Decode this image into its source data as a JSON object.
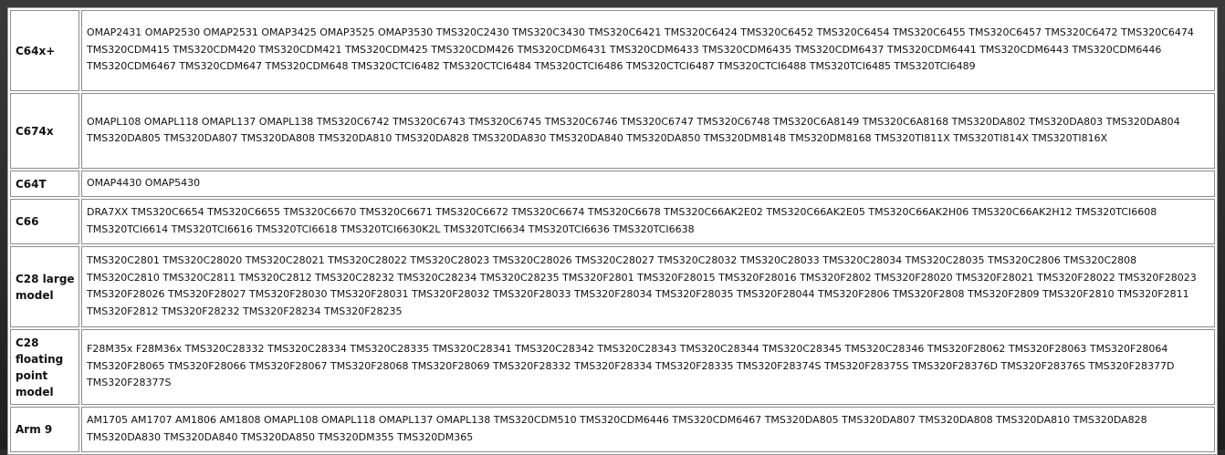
{
  "rows": [
    {
      "family": "C64x+",
      "devices": "OMAP2431 OMAP2530 OMAP2531 OMAP3425 OMAP3525 OMAP3530 TMS320C2430 TMS320C3430 TMS320C6421 TMS320C6424 TMS320C6452 TMS320C6454 TMS320C6455 TMS320C6457 TMS320C6472 TMS320C6474 TMS320CDM415 TMS320CDM420 TMS320CDM421 TMS320CDM425 TMS320CDM426 TMS320CDM6431 TMS320CDM6433 TMS320CDM6435 TMS320CDM6437 TMS320CDM6441 TMS320CDM6443 TMS320CDM6446 TMS320CDM6467 TMS320CDM647 TMS320CDM648 TMS320CTCI6482 TMS320CTCI6484 TMS320CTCI6486 TMS320CTCI6487 TMS320CTCI6488 TMS320TCI6485 TMS320TCI6489"
    },
    {
      "family": "C674x",
      "devices": "OMAPL108 OMAPL118 OMAPL137 OMAPL138 TMS320C6742 TMS320C6743 TMS320C6745 TMS320C6746 TMS320C6747 TMS320C6748 TMS320C6A8149 TMS320C6A8168 TMS320DA802 TMS320DA803 TMS320DA804 TMS320DA805 TMS320DA807 TMS320DA808 TMS320DA810 TMS320DA828 TMS320DA830 TMS320DA840 TMS320DA850 TMS320DM8148 TMS320DM8168 TMS320TI811X TMS320TI814X TMS320TI816X"
    },
    {
      "family": "C64T",
      "devices": "OMAP4430 OMAP5430"
    },
    {
      "family": "C66",
      "devices": "DRA7XX TMS320C6654 TMS320C6655 TMS320C6670 TMS320C6671 TMS320C6672 TMS320C6674 TMS320C6678 TMS320C66AK2E02 TMS320C66AK2E05 TMS320C66AK2H06 TMS320C66AK2H12 TMS320TCI6608 TMS320TCI6614 TMS320TCI6616 TMS320TCI6618 TMS320TCI6630K2L TMS320TCI6634 TMS320TCI6636 TMS320TCI6638"
    },
    {
      "family": "C28 large model",
      "devices": "TMS320C2801 TMS320C28020 TMS320C28021 TMS320C28022 TMS320C28023 TMS320C28026 TMS320C28027 TMS320C28032 TMS320C28033 TMS320C28034 TMS320C28035 TMS320C2806 TMS320C2808 TMS320C2810 TMS320C2811 TMS320C2812 TMS320C28232 TMS320C28234 TMS320C28235 TMS320F2801 TMS320F28015 TMS320F28016 TMS320F2802 TMS320F28020 TMS320F28021 TMS320F28022 TMS320F28023 TMS320F28026 TMS320F28027 TMS320F28030 TMS320F28031 TMS320F28032 TMS320F28033 TMS320F28034 TMS320F28035 TMS320F28044 TMS320F2806 TMS320F2808 TMS320F2809 TMS320F2810 TMS320F2811 TMS320F2812 TMS320F28232 TMS320F28234 TMS320F28235"
    },
    {
      "family": "C28 floating point model",
      "devices": "F28M35x F28M36x TMS320C28332 TMS320C28334 TMS320C28335 TMS320C28341 TMS320C28342 TMS320C28343 TMS320C28344 TMS320C28345 TMS320C28346 TMS320F28062 TMS320F28063 TMS320F28064 TMS320F28065 TMS320F28066 TMS320F28067 TMS320F28068 TMS320F28069 TMS320F28332 TMS320F28334 TMS320F28335 TMS320F28374S TMS320F28375S TMS320F28376D TMS320F28376S TMS320F28377D TMS320F28377S"
    },
    {
      "family": "Arm 9",
      "devices": "AM1705 AM1707 AM1806 AM1808 OMAPL108 OMAPL118 OMAPL137 OMAPL138 TMS320CDM510 TMS320CDM6446 TMS320CDM6467 TMS320DA805 TMS320DA807 TMS320DA808 TMS320DA810 TMS320DA828 TMS320DA830 TMS320DA840 TMS320DA850 TMS320DM355 TMS320DM365"
    }
  ]
}
